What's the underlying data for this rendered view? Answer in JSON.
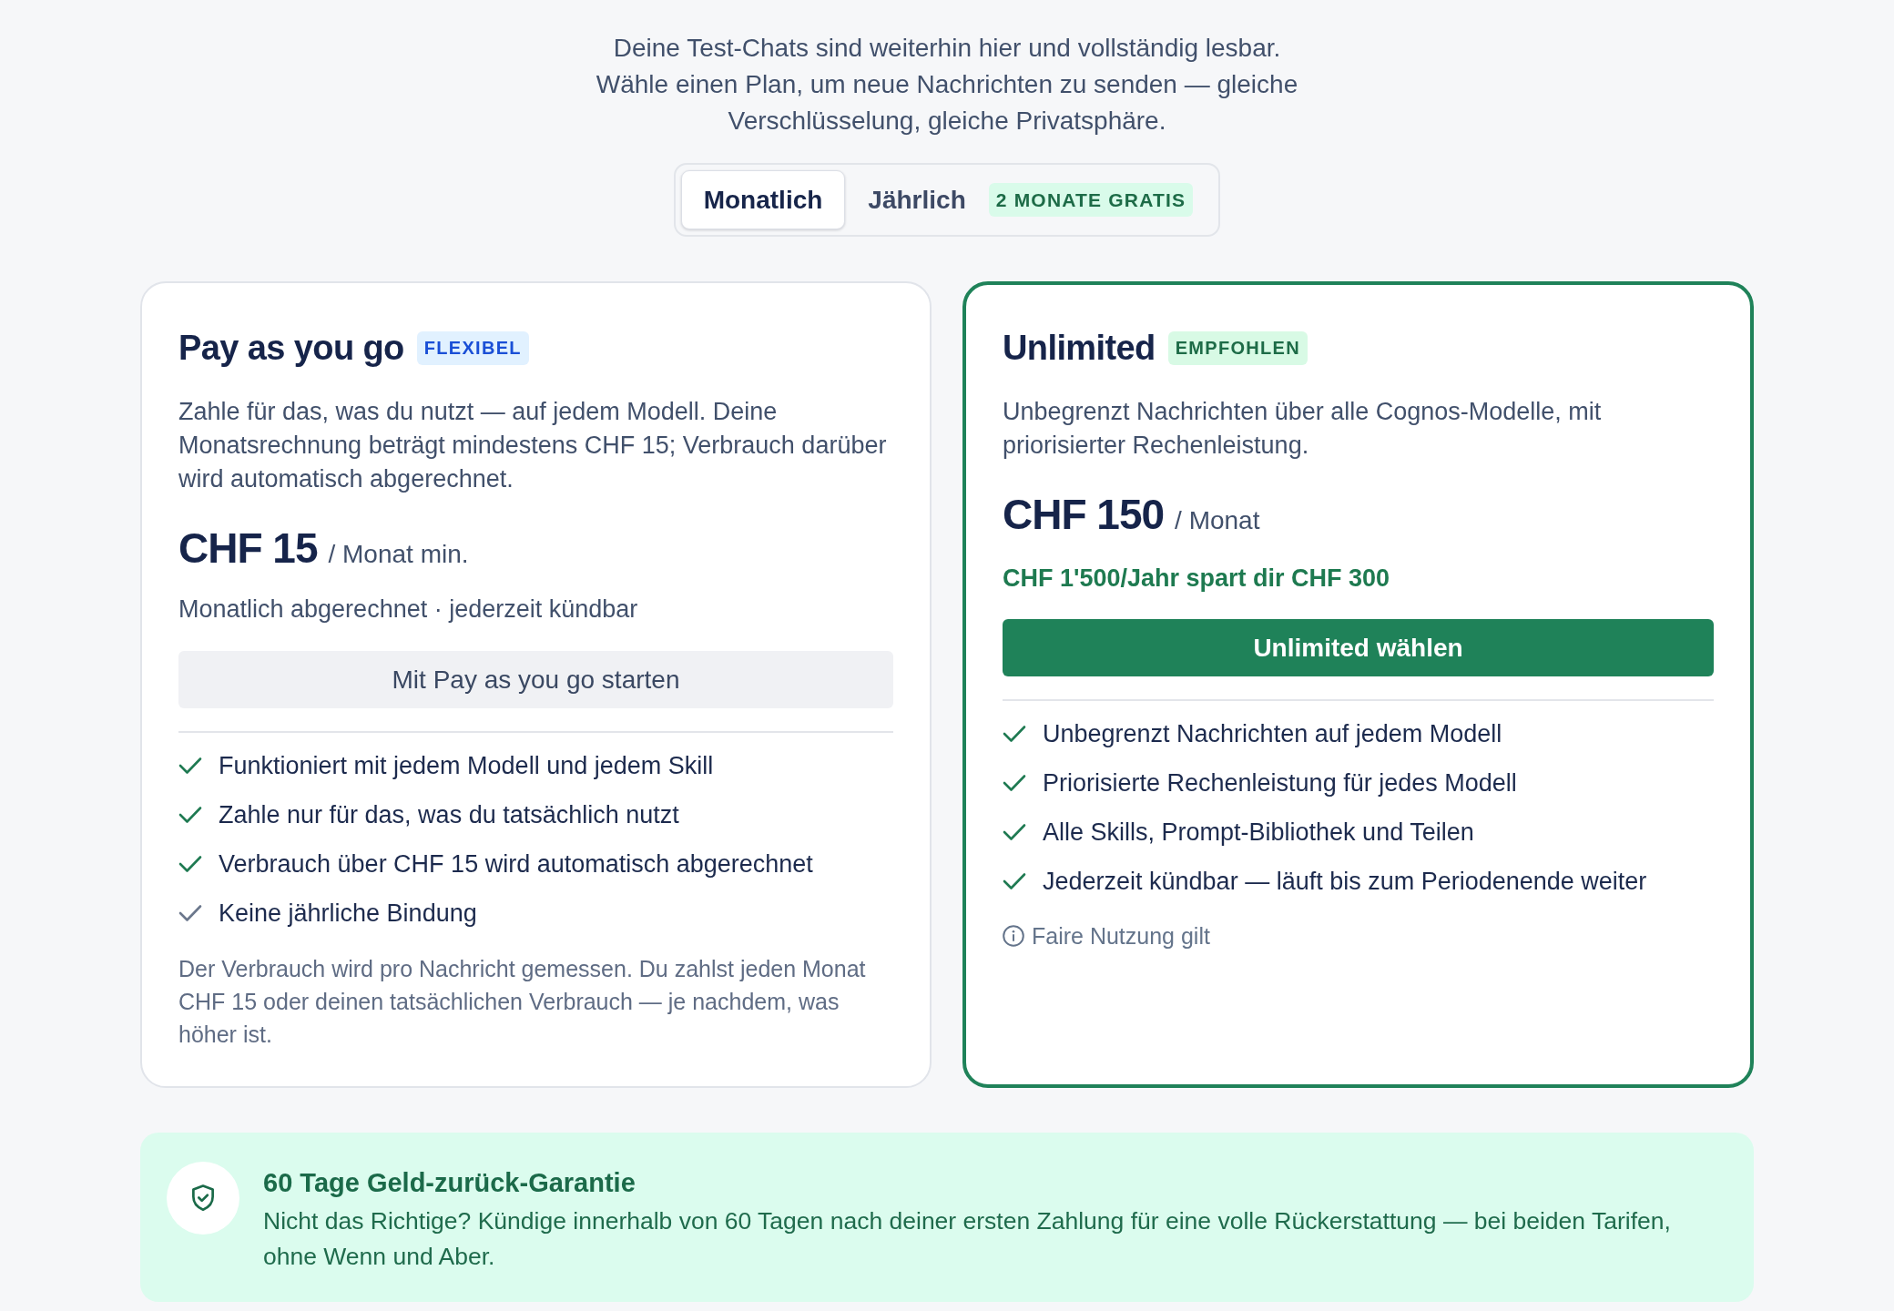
{
  "intro": "Deine Test-Chats sind weiterhin hier und vollständig lesbar. Wähle einen Plan, um neue Nachrichten zu senden — gleiche Verschlüsselung, gleiche Privatsphäre.",
  "billing_toggle": [
    {
      "label": "Monatlich",
      "selected": true
    },
    {
      "label": "Jährlich",
      "selected": false,
      "badge": "2 MONATE GRATIS"
    }
  ],
  "plans": [
    {
      "title": "Pay as you go",
      "badge": {
        "label": "FLEXIBEL",
        "color": "#1a4fd6"
      },
      "highlighted": false,
      "description": "Zahle für das, was du nutzt — auf jedem Modell. Deine Monatsrechnung beträgt mindestens CHF 15; Verbrauch darüber wird automatisch abgerechnet.",
      "price": {
        "amount": "CHF 15",
        "period": "/ Monat min."
      },
      "subline": {
        "kind": "billing",
        "text": "Monatlich abgerechnet · jederzeit kündbar"
      },
      "button": "Mit Pay as you go starten",
      "features": [
        {
          "text": "Funktioniert mit jedem Modell und jedem Skill",
          "dimmed": false
        },
        {
          "text": "Zahle nur für das, was du tatsächlich nutzt",
          "dimmed": false
        },
        {
          "text": "Verbrauch über CHF 15 wird automatisch abgerechnet",
          "dimmed": false
        },
        {
          "text": "Keine jährliche Bindung",
          "dimmed": true
        }
      ],
      "note": {
        "kind": "footnote",
        "text": "Der Verbrauch wird pro Nachricht gemessen. Du zahlst jeden Monat CHF 15 oder deinen tatsächlichen Verbrauch — je nachdem, was höher ist."
      }
    },
    {
      "title": "Unlimited",
      "badge": {
        "label": "EMPFOHLEN",
        "color": "#1d6b47"
      },
      "highlighted": true,
      "description": "Unbegrenzt Nachrichten über alle Cognos-Modelle, mit priorisierter Rechenleistung.",
      "price": {
        "amount": "CHF 150",
        "period": "/ Monat"
      },
      "subline": {
        "kind": "savings",
        "text": "CHF 1'500/Jahr spart dir CHF 300"
      },
      "button": "Unlimited wählen",
      "features": [
        {
          "text": "Unbegrenzt Nachrichten auf jedem Modell",
          "dimmed": false
        },
        {
          "text": "Priorisierte Rechenleistung für jedes Modell",
          "dimmed": false
        },
        {
          "text": "Alle Skills, Prompt-Bibliothek und Teilen",
          "dimmed": false
        },
        {
          "text": "Jederzeit kündbar — läuft bis zum Periodenende weiter",
          "dimmed": false
        }
      ],
      "note": {
        "kind": "info",
        "text": "Faire Nutzung gilt"
      }
    }
  ],
  "guarantee": {
    "title": "60 Tage Geld-zurück-Garantie",
    "text": "Nicht das Richtige? Kündige innerhalb von 60 Tagen nach deiner ersten Zahlung für eine volle Rückerstattung — bei beiden Tarifen, ohne Wenn und Aber."
  }
}
